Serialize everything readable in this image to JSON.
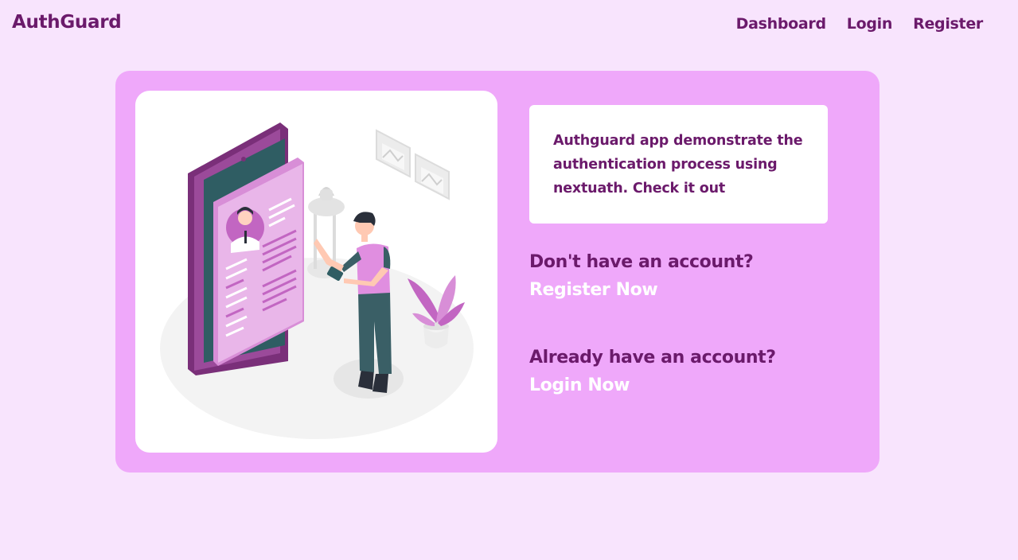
{
  "header": {
    "brand": "AuthGuard",
    "nav": {
      "dashboard": "Dashboard",
      "login": "Login",
      "register": "Register"
    }
  },
  "main": {
    "description": "Authguard app demonstrate the authentication process using nextuath. Check it out",
    "register_cta": {
      "question": "Don't have an account?",
      "link": "Register Now"
    },
    "login_cta": {
      "question": "Already have an account?",
      "link": "Login Now"
    }
  },
  "colors": {
    "page_background": "#f8e4fd",
    "card_background": "#efa8fa",
    "text_primary": "#6b1a6b",
    "link_text": "#ffffff"
  },
  "illustration": "person-with-phone-profile-illustration"
}
